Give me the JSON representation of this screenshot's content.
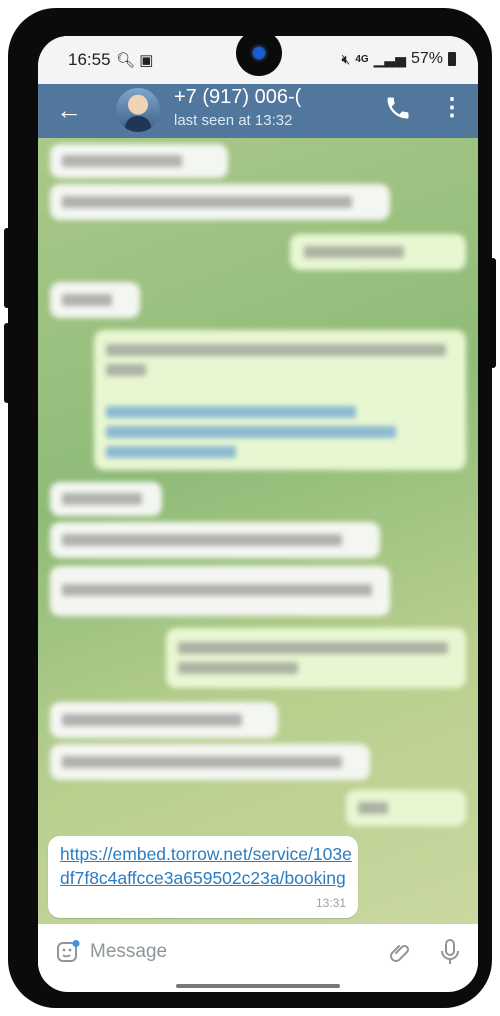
{
  "status_bar": {
    "time": "16:55",
    "battery_percent": "57%",
    "network": "4G"
  },
  "header": {
    "contact_name": "+7 (917) 006-(",
    "last_seen": "last seen at 13:32"
  },
  "last_message": {
    "text": "https://embed.torrow.net/service/103edf7f8c4affcce3a659502c23a/booking",
    "time": "13:31"
  },
  "input": {
    "placeholder": "Message"
  },
  "colors": {
    "header": "#51779d",
    "link": "#2b7cc1",
    "outgoing_bubble": "#e8f7d2",
    "incoming_bubble": "#f4f6f2"
  }
}
